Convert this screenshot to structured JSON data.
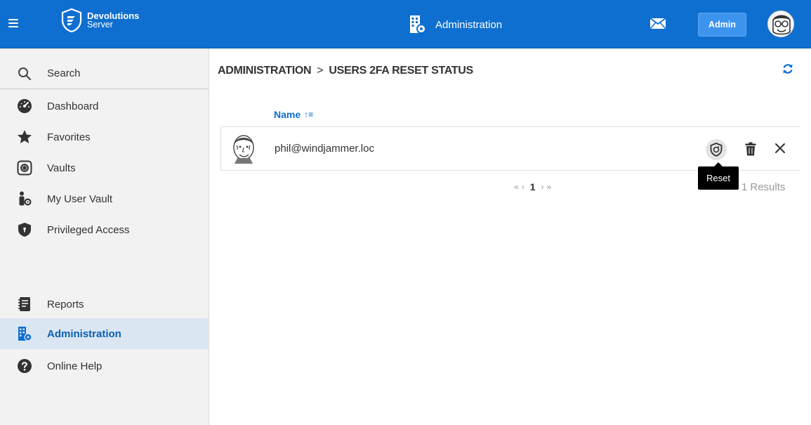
{
  "app": {
    "brand_name": "Devolutions",
    "brand_sub": "Server",
    "section_title": "Administration",
    "admin_button": "Admin"
  },
  "sidebar": {
    "items": [
      {
        "label": "Search",
        "icon": "search-icon"
      },
      {
        "label": "Dashboard",
        "icon": "dashboard-icon"
      },
      {
        "label": "Favorites",
        "icon": "star-icon"
      },
      {
        "label": "Vaults",
        "icon": "vault-icon"
      },
      {
        "label": "My User Vault",
        "icon": "user-vault-icon"
      },
      {
        "label": "Privileged Access",
        "icon": "shield-icon"
      },
      {
        "label": "Reports",
        "icon": "reports-icon"
      },
      {
        "label": "Administration",
        "icon": "administration-icon",
        "active": true
      },
      {
        "label": "Online Help",
        "icon": "help-icon"
      }
    ]
  },
  "breadcrumb": {
    "root": "ADMINISTRATION",
    "separator": ">",
    "current": "USERS 2FA RESET STATUS"
  },
  "table": {
    "column_name": "Name",
    "sort_indicator": "↑≡",
    "rows": [
      {
        "name": "phil@windjammer.loc"
      }
    ]
  },
  "tooltip": {
    "text": "Reset"
  },
  "pagination": {
    "first": "«",
    "prev": "‹",
    "current": "1",
    "next": "›",
    "last": "»",
    "results_count": "1",
    "results_label": "Results"
  },
  "colors": {
    "primary": "#0f6fd0",
    "sidebar_bg": "#f2f2f2",
    "active_bg": "#dae6f2"
  }
}
